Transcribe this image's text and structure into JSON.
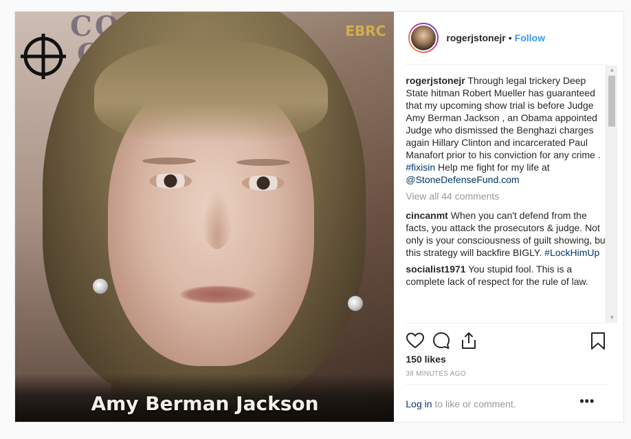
{
  "post": {
    "image_caption": "Amy Berman Jackson",
    "image_watermark": "EBRC",
    "image_bg_letters": [
      "CO",
      "C F"
    ]
  },
  "header": {
    "username": "rogerjstonejr",
    "separator": "•",
    "follow_label": "Follow"
  },
  "caption": {
    "username": "rogerjstonejr",
    "text": " Through legal trickery Deep State hitman Robert Mueller has guaranteed that my upcoming show trial is before Judge Amy Berman Jackson , an Obama appointed Judge who dismissed the Benghazi charges again Hillary Clinton and incarcerated Paul Manafort prior to his conviction for any crime . ",
    "hashtag": "#fixisin",
    "text2": " Help me fight for my life at ",
    "mention": "@StoneDefenseFund.com"
  },
  "view_all_comments": "View all 44 comments",
  "comments": [
    {
      "username": "cincanmt",
      "text": " When you can't defend from the facts, you attack the prosecutors & judge. Not only is your consciousness of guilt showing, but this strategy will backfire BIGLY. ",
      "hashtag": "#LockHimUp"
    },
    {
      "username": "socialist1971",
      "text": " You stupid fool. This is a complete lack of respect for the rule of law."
    }
  ],
  "likes": "150 likes",
  "timestamp": "38 MINUTES AGO",
  "login": {
    "link": "Log in",
    "text": " to like or comment."
  },
  "more_label": "•••",
  "icons": {
    "like": "heart-icon",
    "comment": "comment-icon",
    "share": "share-icon",
    "save": "bookmark-icon"
  },
  "colors": {
    "link_blue": "#3897f0",
    "hashtag": "#003569",
    "muted": "#999999",
    "text": "#262626"
  }
}
